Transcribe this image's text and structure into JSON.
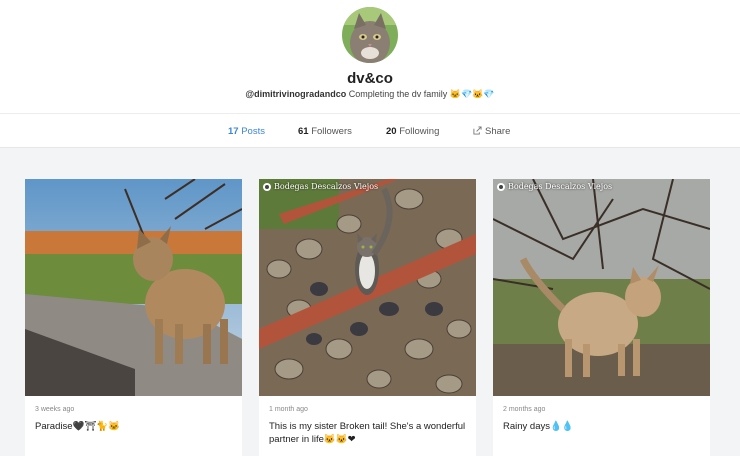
{
  "profile": {
    "name": "dv&co",
    "handle": "@dimitrivinogradandco",
    "bio": "Completing the dv family 🐱💎🐱💎"
  },
  "stats": {
    "posts": {
      "count": "17",
      "label": "Posts"
    },
    "followers": {
      "count": "61",
      "label": "Followers"
    },
    "following": {
      "count": "20",
      "label": "Following"
    },
    "share_label": "Share"
  },
  "posts": [
    {
      "time": "3 weeks ago",
      "caption": "Paradise🖤⛩🐈🐱",
      "location": ""
    },
    {
      "time": "1 month ago",
      "caption": "This is my sister Broken tail! She's a wonderful partner in life🐱🐱❤",
      "location": "Bodegas Descalzos Viejos"
    },
    {
      "time": "2 months ago",
      "caption": "Rainy days💧💧",
      "location": "Bodegas Descalzos Viejos"
    }
  ],
  "colors": {
    "accent": "#3b86d8",
    "background": "#f3f4f6"
  },
  "icons": {
    "share": "share-icon",
    "location": "pin-icon"
  }
}
